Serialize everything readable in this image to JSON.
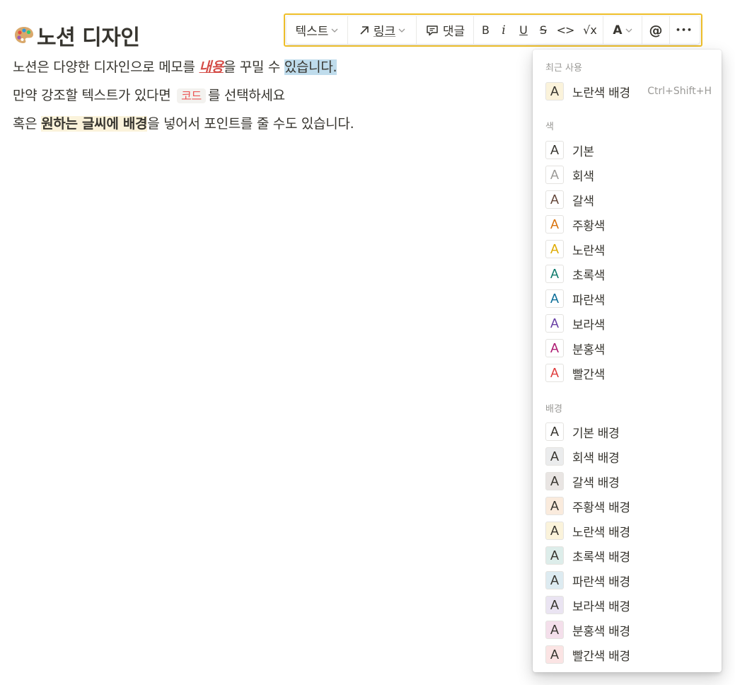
{
  "page": {
    "title": "노션 디자인",
    "icon": "artist-palette-icon"
  },
  "content": {
    "p1": {
      "a": "노션은 다양한 디자인으로  메모를 ",
      "b": "내용",
      "c": "을 꾸밀 수 ",
      "d": "있습니다."
    },
    "p2": {
      "a": "만약 강조할 텍스트가 있다면 ",
      "code": "코드",
      "c": "를 선택하세요"
    },
    "p3": {
      "a": "혹은 ",
      "b": "원하는 글씨에 배경",
      "c": "을 넣어서 포인트를 줄 수도 있습니다."
    }
  },
  "toolbar": {
    "text_type": "텍스트",
    "link": "링크",
    "comment": "댓글",
    "bold": "B",
    "italic": "i",
    "underline": "U",
    "strike": "S",
    "code": "<>",
    "equation": "√x",
    "color": "A",
    "mention": "@",
    "more": "•••"
  },
  "menu": {
    "recent_title": "최근 사용",
    "recent": [
      {
        "label": "노란색 배경",
        "shortcut": "Ctrl+Shift+H",
        "fg": "#37352f",
        "bg": "#fbf3db"
      }
    ],
    "color_title": "색",
    "colors": [
      {
        "label": "기본",
        "fg": "#37352f"
      },
      {
        "label": "회색",
        "fg": "#9b9a97"
      },
      {
        "label": "갈색",
        "fg": "#64473a"
      },
      {
        "label": "주황색",
        "fg": "#d9730d"
      },
      {
        "label": "노란색",
        "fg": "#dfab01"
      },
      {
        "label": "초록색",
        "fg": "#0f7b6c"
      },
      {
        "label": "파란색",
        "fg": "#0b6e99"
      },
      {
        "label": "보라색",
        "fg": "#6940a5"
      },
      {
        "label": "분홍색",
        "fg": "#ad1a72"
      },
      {
        "label": "빨간색",
        "fg": "#e03e3e"
      }
    ],
    "bg_title": "배경",
    "backgrounds": [
      {
        "label": "기본 배경",
        "bg": "#ffffff"
      },
      {
        "label": "회색 배경",
        "bg": "#ebeced"
      },
      {
        "label": "갈색 배경",
        "bg": "#e9e5e3"
      },
      {
        "label": "주황색 배경",
        "bg": "#faebdd"
      },
      {
        "label": "노란색 배경",
        "bg": "#fbf3db"
      },
      {
        "label": "초록색 배경",
        "bg": "#ddedea"
      },
      {
        "label": "파란색 배경",
        "bg": "#ddebf1"
      },
      {
        "label": "보라색 배경",
        "bg": "#eae4f2"
      },
      {
        "label": "분홍색 배경",
        "bg": "#f4dfeb"
      },
      {
        "label": "빨간색 배경",
        "bg": "#fbe4e4"
      }
    ],
    "swatch_letter": "A"
  }
}
